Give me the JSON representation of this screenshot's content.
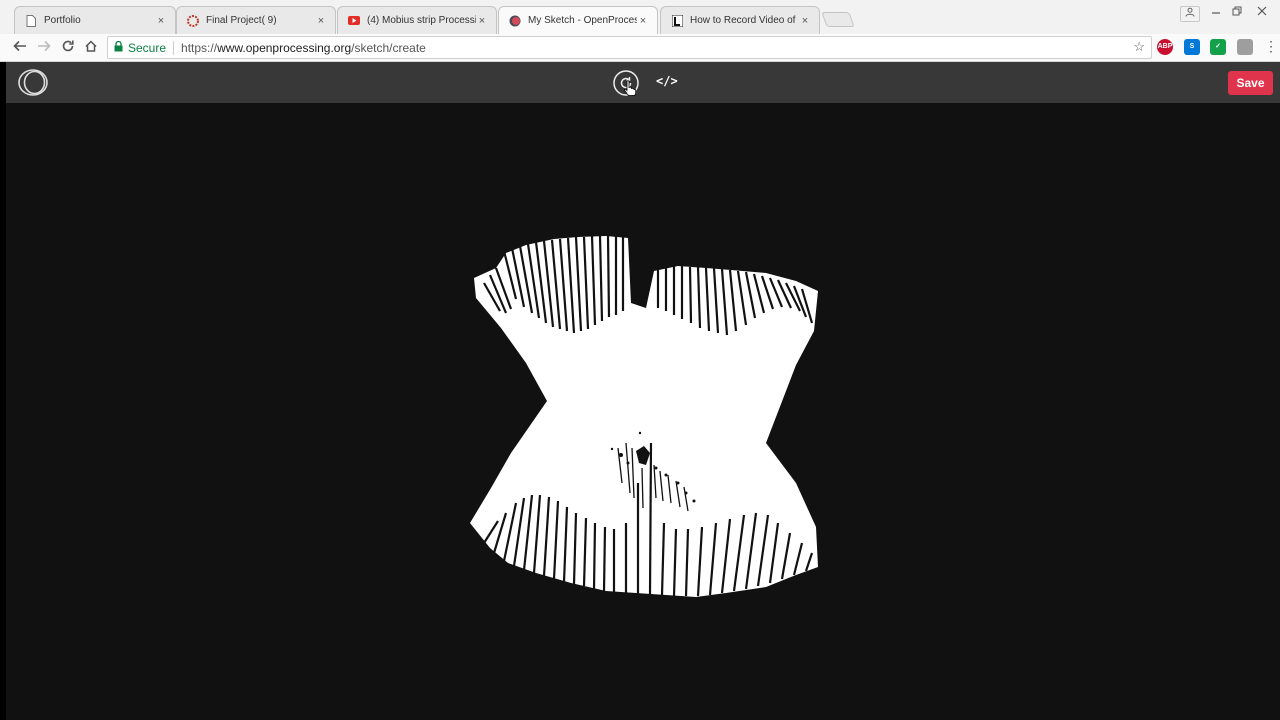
{
  "browser": {
    "tabs": [
      {
        "title": "Portfolio",
        "icon": "page-icon",
        "active": false
      },
      {
        "title": "Final Project( 9)",
        "icon": "asu-icon",
        "active": false
      },
      {
        "title": "(4) Mobius strip Processi",
        "icon": "youtube-icon",
        "active": false
      },
      {
        "title": "My Sketch - OpenProces",
        "icon": "openprocessing-icon",
        "active": true
      },
      {
        "title": "How to Record Video of",
        "icon": "l-icon",
        "active": false
      }
    ],
    "close_glyph": "×",
    "address": {
      "secure_label": "Secure",
      "url_scheme": "https://",
      "url_host": "www.openprocessing.org",
      "url_path": "/sketch/create"
    },
    "extensions": [
      {
        "name": "adblock-icon",
        "label": "ABP",
        "color": "#c8102e"
      },
      {
        "name": "skype-icon",
        "label": "S",
        "color": "#0078d7"
      },
      {
        "name": "grammarly-icon",
        "label": "✓",
        "color": "#15a04a"
      },
      {
        "name": "extension-puzzle-icon",
        "label": "",
        "color": "#9e9e9e"
      }
    ]
  },
  "app": {
    "save_label": "Save",
    "code_label": "</>",
    "accent": "#e0344c",
    "header_bg": "#383838",
    "canvas_bg": "#111111"
  }
}
